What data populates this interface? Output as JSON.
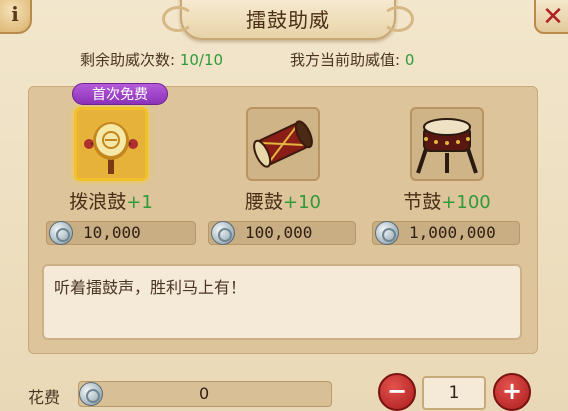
{
  "header": {
    "title": "擂鼓助威",
    "info_label": "i",
    "close_label": "✕"
  },
  "status": {
    "remaining_label": "剩余助威次数:",
    "remaining_value": "10/10",
    "current_label": "我方当前助威值:",
    "current_value": "0"
  },
  "badge": {
    "label": "首次免费"
  },
  "drums": [
    {
      "name": "拨浪鼓",
      "bonus": "+1",
      "price": "10,000",
      "icon": "rattle-drum-icon",
      "selected": true
    },
    {
      "name": "腰鼓",
      "bonus": "+10",
      "price": "100,000",
      "icon": "waist-drum-icon",
      "selected": false
    },
    {
      "name": "节鼓",
      "bonus": "+100",
      "price": "1,000,000",
      "icon": "festival-drum-icon",
      "selected": false
    }
  ],
  "message": {
    "text": "听着擂鼓声，胜利马上有！"
  },
  "footer": {
    "cost_label": "花费",
    "cost_value": "0",
    "minus_label": "−",
    "plus_label": "+",
    "quantity": "1"
  },
  "colors": {
    "accent_green": "#2e9a3a",
    "badge_purple": "#8a32b8",
    "button_red": "#a81d1d"
  }
}
